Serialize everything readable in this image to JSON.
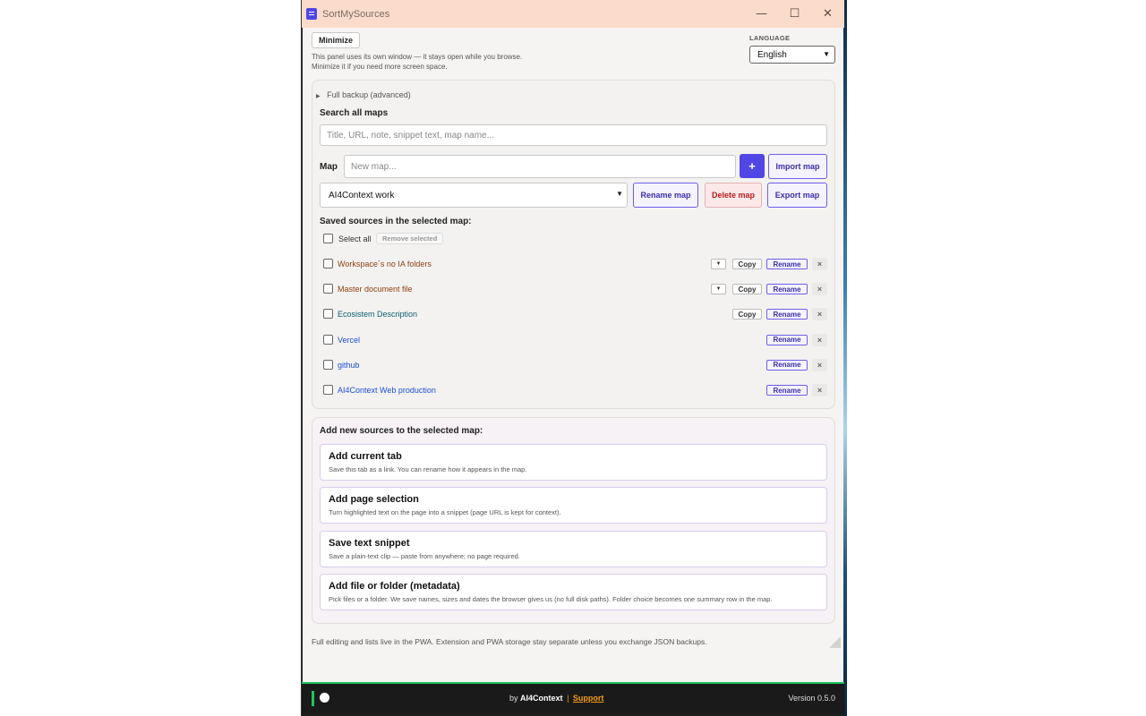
{
  "window": {
    "title": "SortMySources",
    "controls": {
      "minimize": "—",
      "maximize": "☐",
      "close": "✕"
    }
  },
  "header": {
    "minimize_label": "Minimize",
    "hint_line1": "This panel uses its own window — it stays open while you browse.",
    "hint_line2": "Minimize it if you need more screen space.",
    "language_label": "LANGUAGE",
    "language_value": "English"
  },
  "backup": {
    "summary": "Full backup (advanced)"
  },
  "search": {
    "title": "Search all maps",
    "placeholder": "Title, URL, note, snippet text, map name..."
  },
  "map": {
    "label": "Map",
    "new_placeholder": "New map...",
    "plus": "+",
    "import_label": "Import map",
    "selected": "AI4Context work",
    "rename_label": "Rename map",
    "delete_label": "Delete map",
    "export_label": "Export map"
  },
  "saved": {
    "title": "Saved sources in the selected map:",
    "select_all": "Select all",
    "remove_selected": "Remove selected",
    "copy_label": "Copy",
    "rename_label": "Rename",
    "caret": "▼",
    "remove": "×",
    "items": [
      {
        "name": "Workspace´s no IA folders",
        "color": "#92400e"
      },
      {
        "name": "Master document file",
        "color": "#92400e"
      },
      {
        "name": "Ecosistem Description",
        "color": "#0f5f6f"
      },
      {
        "name": "Vercel",
        "color": "#1d4ed8"
      },
      {
        "name": "github",
        "color": "#1d4ed8"
      },
      {
        "name": "AI4Context Web production",
        "color": "#1d4ed8"
      }
    ]
  },
  "add": {
    "title": "Add new sources to the selected map:",
    "options": [
      {
        "title": "Add current tab",
        "desc": "Save this tab as a link. You can rename how it appears in the map."
      },
      {
        "title": "Add page selection",
        "desc": "Turn highlighted text on the page into a snippet (page URL is kept for context)."
      },
      {
        "title": "Save text snippet",
        "desc": "Save a plain-text clip — paste from anywhere; no page required."
      },
      {
        "title": "Add file or folder (metadata)",
        "desc": "Pick files or a folder. We save names, sizes and dates the browser gives us (no full disk paths). Folder choice becomes one summary row in the map."
      }
    ]
  },
  "footnote": "Full editing and lists live in the PWA. Extension and PWA storage stay separate unless you exchange JSON backups.",
  "footer": {
    "by": "by",
    "brand": "AI4Context",
    "sep": "|",
    "support": "Support",
    "version": "Version 0.5.0"
  }
}
